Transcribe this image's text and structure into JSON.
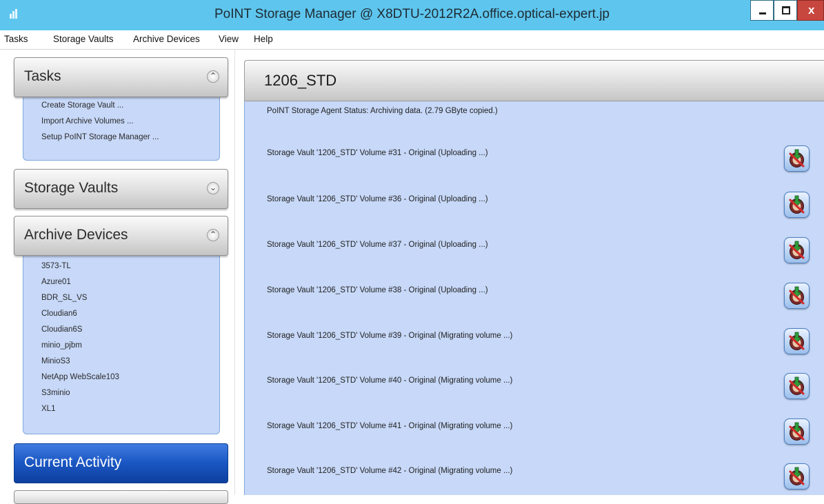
{
  "window": {
    "title": "PoINT Storage Manager @ X8DTU-2012R2A.office.optical-expert.jp"
  },
  "menu": [
    "Tasks",
    "Storage Vaults",
    "Archive Devices",
    "View",
    "Help"
  ],
  "sidebar": {
    "tasks": {
      "title": "Tasks",
      "items": [
        "Create Storage Vault ...",
        "Import Archive Volumes ...",
        "Setup PoINT Storage Manager ..."
      ]
    },
    "storage_vaults": {
      "title": "Storage Vaults"
    },
    "archive_devices": {
      "title": "Archive Devices",
      "items": [
        "3573-TL",
        "Azure01",
        "BDR_SL_VS",
        "Cloudian6",
        "Cloudian6S",
        "minio_pjbm",
        "MinioS3",
        "NetApp WebScale103",
        "S3minio",
        "XL1"
      ]
    },
    "current_activity": {
      "title": "Current Activity"
    }
  },
  "main": {
    "title": "1206_STD",
    "status": "PoINT Storage Agent Status: Archiving data. (2.79 GByte copied.)",
    "volumes": [
      "Storage Vault '1206_STD' Volume #31 - Original (Uploading ...)",
      "Storage Vault '1206_STD' Volume #36 - Original (Uploading ...)",
      "Storage Vault '1206_STD' Volume #37 - Original (Uploading ...)",
      "Storage Vault '1206_STD' Volume #38 - Original (Uploading ...)",
      "Storage Vault '1206_STD' Volume #39 - Original (Migrating volume ...)",
      "Storage Vault '1206_STD' Volume #40 - Original (Migrating volume ...)",
      "Storage Vault '1206_STD' Volume #41 - Original (Migrating volume ...)",
      "Storage Vault '1206_STD' Volume #42 - Original (Migrating volume ...)"
    ],
    "action_icon": "cancel-transfer-icon"
  },
  "colors": {
    "titlebar": "#5ec6ee",
    "content_background": "#c7d8f8",
    "current_activity": "#1a56c2",
    "close_button": "#c7463e"
  }
}
